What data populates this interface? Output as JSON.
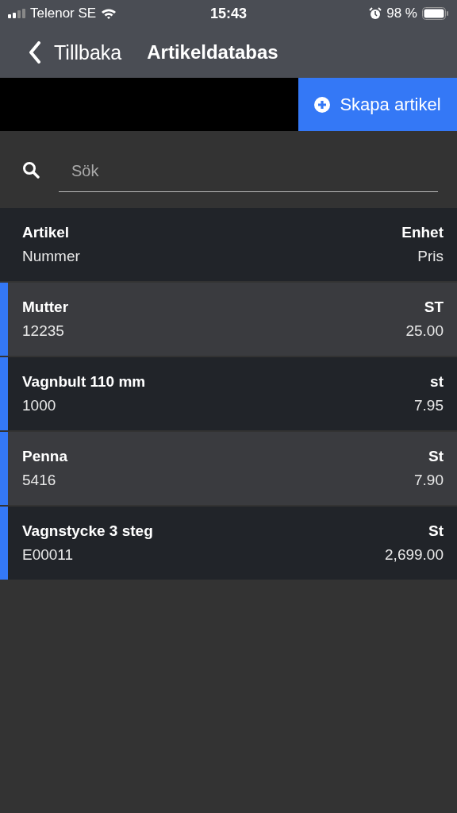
{
  "status_bar": {
    "carrier": "Telenor SE",
    "time": "15:43",
    "battery": "98 %"
  },
  "nav": {
    "back": "Tillbaka",
    "title": "Artikeldatabas"
  },
  "create_button": "Skapa artikel",
  "search": {
    "placeholder": "Sök"
  },
  "table": {
    "header": {
      "name": "Artikel",
      "unit": "Enhet",
      "number": "Nummer",
      "price": "Pris"
    },
    "rows": [
      {
        "name": "Mutter",
        "unit": "ST",
        "number": "12235",
        "price": "25.00"
      },
      {
        "name": "Vagnbult 110 mm",
        "unit": "st",
        "number": "1000",
        "price": "7.95"
      },
      {
        "name": "Penna",
        "unit": "St",
        "number": "5416",
        "price": "7.90"
      },
      {
        "name": "Vagnstycke 3 steg",
        "unit": "St",
        "number": "E00011",
        "price": "2,699.00"
      }
    ]
  }
}
